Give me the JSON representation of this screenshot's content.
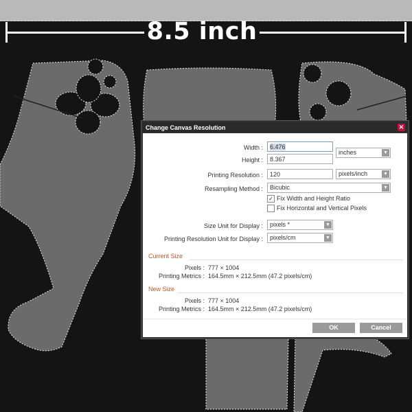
{
  "canvas": {
    "measurement_label": "8.5 inch"
  },
  "dialog": {
    "title": "Change Canvas Resolution",
    "close_glyph": "×",
    "width_label": "Width :",
    "width_value": "6.476",
    "height_label": "Height :",
    "height_value": "8.367",
    "size_unit": "inches",
    "printing_resolution_label": "Printing Resolution :",
    "printing_resolution_value": "120",
    "resolution_unit": "pixels/inch",
    "resampling_label": "Resampling Method :",
    "resampling_value": "Bicubic",
    "fix_ratio_label": "Fix Width and Height Ratio",
    "fix_ratio_checked": true,
    "fix_pixels_label": "Fix Horizontal and Vertical Pixels",
    "fix_pixels_checked": false,
    "size_unit_display_label": "Size Unit for Display :",
    "size_unit_display_value": "pixels *",
    "print_res_unit_display_label": "Printing Resolution Unit for Display :",
    "print_res_unit_display_value": "pixels/cm",
    "current_size": {
      "title": "Current Size",
      "pixels_label": "Pixels :",
      "pixels_value": "777 × 1004",
      "metrics_label": "Printing Metrics :",
      "metrics_value": "164.5mm × 212.5mm (47.2 pixels/cm)"
    },
    "new_size": {
      "title": "New Size",
      "pixels_label": "Pixels :",
      "pixels_value": "777 × 1004",
      "metrics_label": "Printing Metrics :",
      "metrics_value": "164.5mm × 212.5mm (47.2 pixels/cm)"
    },
    "ok_label": "OK",
    "cancel_label": "Cancel",
    "dropdown_icon": "chevron-down-icon",
    "check_glyph": "✓"
  },
  "colors": {
    "canvas_bg": "#141414",
    "pattern_fill": "#6b6b6b",
    "dialog_title_bg": "#2a2a2a",
    "close_button": "#b8123c",
    "section_title": "#c0562e",
    "button_bg": "#9a9a9a"
  }
}
